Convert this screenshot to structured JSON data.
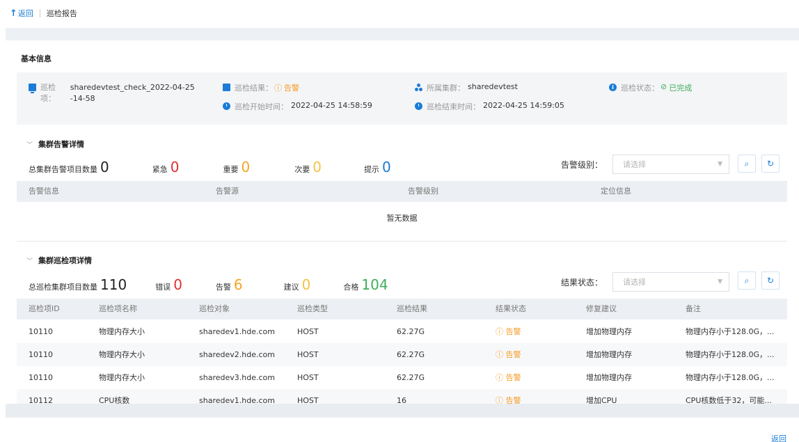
{
  "header": {
    "back_label": "返回",
    "title": "巡检报告"
  },
  "basic": {
    "section_title": "基本信息",
    "item_label": "巡检项：",
    "item_value": "sharedevtest_check_2022-04-25-14-58",
    "result_label": "巡检结果：",
    "result_value": "告警",
    "cluster_label": "所属集群：",
    "cluster_value": "sharedevtest",
    "status_label": "巡检状态：",
    "status_value": "已完成",
    "start_label": "巡检开始时间：",
    "start_value": "2022-04-25 14:58:59",
    "end_label": "巡检结束时间：",
    "end_value": "2022-04-25 14:59:05"
  },
  "alarm": {
    "section_title": "集群告警详情",
    "total_label": "总集群告警项目数量",
    "total": "0",
    "urgent_label": "紧急",
    "urgent": "0",
    "important_label": "重要",
    "important": "0",
    "minor_label": "次要",
    "minor": "0",
    "hint_label": "提示",
    "hint": "0",
    "filter_label": "告警级别：",
    "filter_placeholder": "请选择",
    "columns": [
      "告警信息",
      "告警源",
      "告警级别",
      "定位信息"
    ],
    "empty_text": "暂无数据"
  },
  "inspection": {
    "section_title": "集群巡检项详情",
    "total_label": "总巡检集群项目数量",
    "total": "110",
    "error_label": "错误",
    "error": "0",
    "warning_label": "告警",
    "warning": "6",
    "suggest_label": "建议",
    "suggest": "0",
    "pass_label": "合格",
    "pass": "104",
    "filter_label": "结果状态：",
    "filter_placeholder": "请选择",
    "columns": [
      "巡检项ID",
      "巡检项名称",
      "巡检对象",
      "巡检类型",
      "巡检结果",
      "结果状态",
      "修复建议",
      "备注"
    ],
    "rows": [
      [
        "10110",
        "物理内存大小",
        "sharedev1.hde.com",
        "HOST",
        "62.27G",
        "告警",
        "增加物理内存",
        "物理内存小于128.0G，..."
      ],
      [
        "10110",
        "物理内存大小",
        "sharedev2.hde.com",
        "HOST",
        "62.27G",
        "告警",
        "增加物理内存",
        "物理内存小于128.0G，..."
      ],
      [
        "10110",
        "物理内存大小",
        "sharedev3.hde.com",
        "HOST",
        "62.27G",
        "告警",
        "增加物理内存",
        "物理内存小于128.0G，..."
      ],
      [
        "10112",
        "CPU核数",
        "sharedev1.hde.com",
        "HOST",
        "16",
        "告警",
        "增加CPU",
        "CPU核数低于32，可能..."
      ]
    ]
  },
  "footer": {
    "return_label": "返回"
  },
  "colors": {
    "accent": "#1a7cd6",
    "urgent": "#e0302f",
    "warning": "#f5a623",
    "info": "#1a7cd6",
    "pass": "#3dae5a"
  }
}
